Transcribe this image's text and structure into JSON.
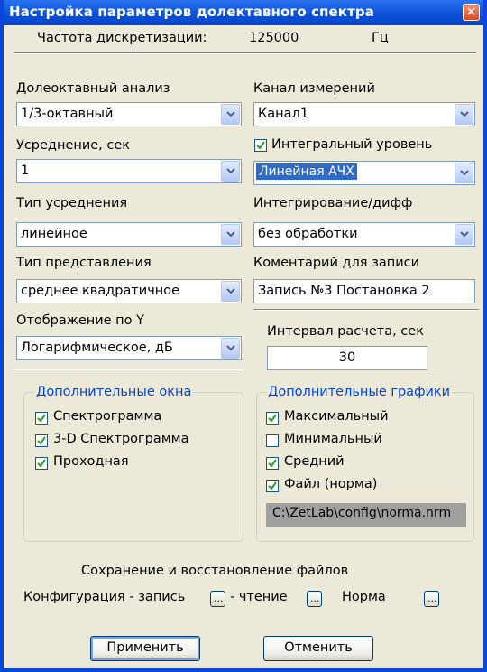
{
  "window": {
    "title": "Настройка параметров долектавного спектра",
    "close_glyph": "×"
  },
  "header": {
    "sampling_label": "Частота дискретизации:",
    "sampling_value": "125000",
    "sampling_unit": "Гц"
  },
  "left": {
    "analysis_label": "Долеоктавный анализ",
    "analysis_value": "1/3-октавный",
    "averaging_label": "Усреднение, сек",
    "averaging_value": "1",
    "avg_type_label": "Тип усреднения",
    "avg_type_value": "линейное",
    "repr_label": "Тип представления",
    "repr_value": "среднее квадратичное",
    "yaxis_label": "Отображение по Y",
    "yaxis_value": "Логарифмическое, дБ"
  },
  "right": {
    "channel_label": "Канал измерений",
    "channel_value": "Канал1",
    "integral_label": "Интегральный уровень",
    "integral_checked": true,
    "integral_value": "Линейная АЧХ",
    "integ_label": "Интегрирование/дифф",
    "integ_value": "без обработки",
    "comment_label": "Коментарий для записи",
    "comment_value": "Запись №3 Постановка 2",
    "interval_label": "Интервал расчета, сек",
    "interval_value": "30"
  },
  "extra_windows": {
    "title": "Дополнительные окна",
    "items": [
      {
        "label": "Спектрограмма",
        "checked": true
      },
      {
        "label": "3-D Спектрограмма",
        "checked": true
      },
      {
        "label": "Проходная",
        "checked": true
      }
    ]
  },
  "extra_graphs": {
    "title": "Дополнительные графики",
    "items": [
      {
        "label": "Максимальный",
        "checked": true
      },
      {
        "label": "Минимальный",
        "checked": false
      },
      {
        "label": "Средний",
        "checked": true
      },
      {
        "label": "Файл (норма)",
        "checked": true
      }
    ],
    "norm_path": "C:\\ZetLab\\config\\norma.nrm"
  },
  "files": {
    "title": "Сохранение и восстановление файлов",
    "config_label": "Конфигурация - запись",
    "read_label": "- чтение",
    "norm_label": "Норма",
    "browse_label": "..."
  },
  "buttons": {
    "apply": "Применить",
    "cancel": "Отменить"
  },
  "colors": {
    "titlebar": "#0a4fd8",
    "group_title": "#0046d5",
    "highlight": "#316ac5",
    "path_bg": "#a0a0a0"
  },
  "icons": {
    "combo_arrow": "chevron-down-icon",
    "check": "check-icon",
    "close": "close-icon"
  }
}
